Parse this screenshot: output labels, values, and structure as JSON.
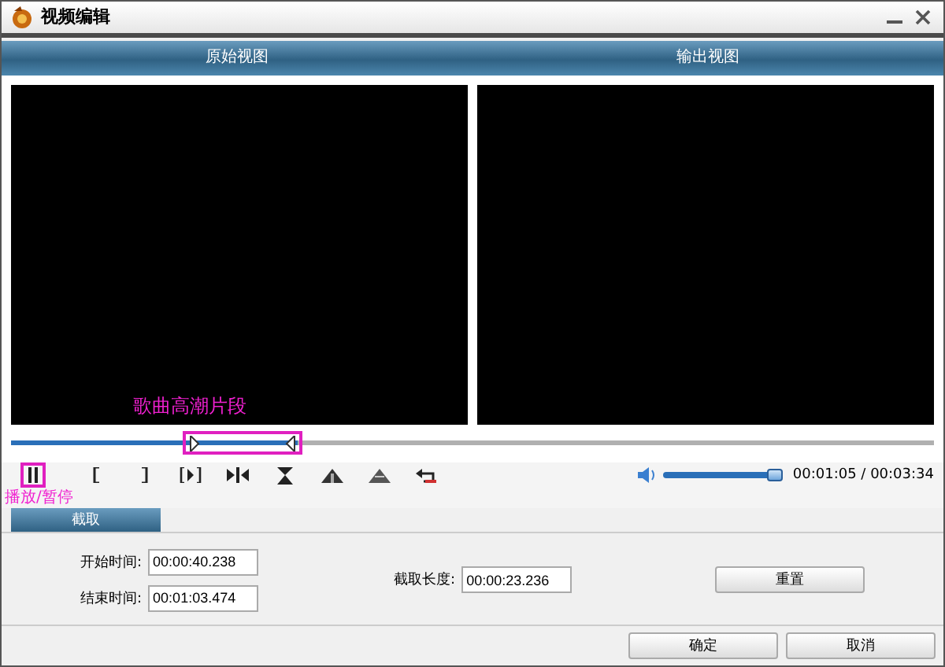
{
  "window": {
    "title": "视频编辑"
  },
  "views": [
    {
      "label": "原始视图"
    },
    {
      "label": "输出视图"
    }
  ],
  "seek": {
    "level": 0.31,
    "annotation": "歌曲高潮片段"
  },
  "controls": [
    {
      "kind": "pause",
      "highlighted": true
    },
    {
      "kind": "mark-in",
      "highlighted": false
    },
    {
      "kind": "mark-out",
      "highlighted": false
    },
    {
      "kind": "play-selection",
      "highlighted": false
    },
    {
      "kind": "to-marks",
      "highlighted": false
    },
    {
      "kind": "hourglass",
      "highlighted": false
    },
    {
      "kind": "up-a",
      "highlighted": false
    },
    {
      "kind": "up-b",
      "highlighted": false
    },
    {
      "kind": "undo",
      "highlighted": false
    }
  ],
  "control_annotation": "播放/暂停",
  "time": "00:01:05 / 00:03:34",
  "tabs": [
    {
      "label": "截取",
      "selected": true
    }
  ],
  "form": {
    "start_label": "开始时间:",
    "start": "00:00:40.238",
    "end_label": "结束时间:",
    "end": "00:01:03.474",
    "length_label": "截取长度:",
    "length": "00:00:23.236",
    "reset": "重置"
  },
  "buttons": [
    "确定",
    "取消"
  ]
}
